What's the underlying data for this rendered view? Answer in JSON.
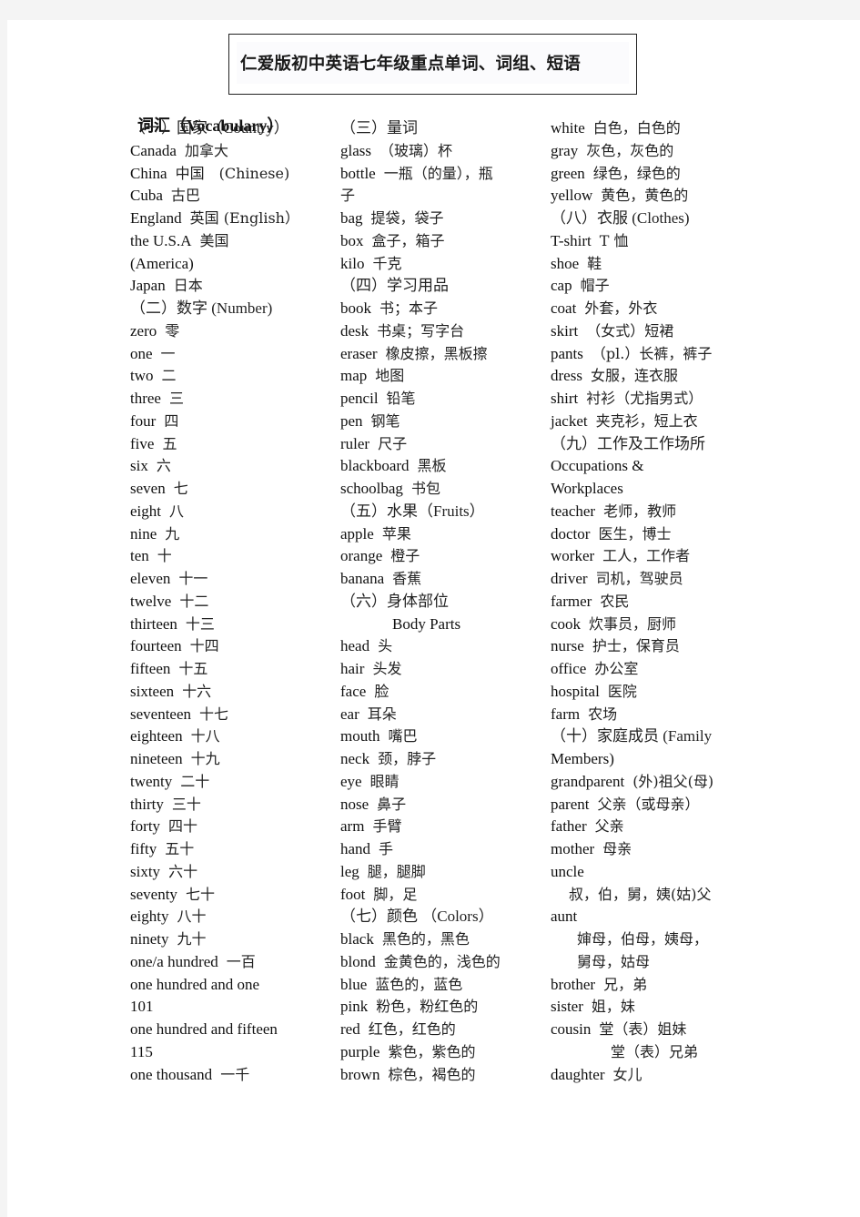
{
  "document": {
    "title": "仁爱版初中英语七年级重点单词、词组、短语",
    "vocab_heading": "词汇（Vocabulary）"
  },
  "columns": [
    {
      "lines": [
        {
          "type": "section",
          "text": "（一）国家（Country）"
        },
        {
          "type": "entry",
          "en": "Canada",
          "zh": "加拿大"
        },
        {
          "type": "entry",
          "en": "China",
          "zh": "中国　(Chinese)"
        },
        {
          "type": "entry",
          "en": "Cuba",
          "zh": "古巴"
        },
        {
          "type": "entry",
          "en": "England",
          "zh": "英国 (English）"
        },
        {
          "type": "entry",
          "en": "the U.S.A",
          "zh": "美国"
        },
        {
          "type": "text",
          "text": "(America)"
        },
        {
          "type": "entry",
          "en": "Japan",
          "zh": "日本"
        },
        {
          "type": "section",
          "text": "（二）数字 (Number)"
        },
        {
          "type": "entry",
          "en": "zero",
          "zh": "零"
        },
        {
          "type": "entry",
          "en": "one",
          "zh": "一"
        },
        {
          "type": "entry",
          "en": "two",
          "zh": "二"
        },
        {
          "type": "entry",
          "en": "three",
          "zh": "三"
        },
        {
          "type": "entry",
          "en": "four",
          "zh": "四"
        },
        {
          "type": "entry",
          "en": "five",
          "zh": "五"
        },
        {
          "type": "entry",
          "en": "six",
          "zh": "六"
        },
        {
          "type": "entry",
          "en": "seven",
          "zh": "七"
        },
        {
          "type": "entry",
          "en": "eight",
          "zh": "八"
        },
        {
          "type": "entry",
          "en": "nine",
          "zh": "九"
        },
        {
          "type": "entry",
          "en": "ten",
          "zh": "十"
        },
        {
          "type": "entry",
          "en": "eleven",
          "zh": "十一"
        },
        {
          "type": "entry",
          "en": "twelve",
          "zh": "十二"
        },
        {
          "type": "entry",
          "en": "thirteen",
          "zh": "十三"
        },
        {
          "type": "entry",
          "en": "fourteen",
          "zh": "十四"
        },
        {
          "type": "entry",
          "en": "fifteen",
          "zh": "十五"
        },
        {
          "type": "entry",
          "en": "sixteen",
          "zh": "十六"
        },
        {
          "type": "entry",
          "en": "seventeen",
          "zh": "十七"
        },
        {
          "type": "entry",
          "en": "eighteen",
          "zh": "十八"
        },
        {
          "type": "entry",
          "en": "nineteen",
          "zh": "十九"
        },
        {
          "type": "entry",
          "en": "twenty",
          "zh": "二十"
        },
        {
          "type": "entry",
          "en": "thirty",
          "zh": "三十"
        },
        {
          "type": "entry",
          "en": "forty",
          "zh": "四十"
        },
        {
          "type": "entry",
          "en": "fifty",
          "zh": "五十"
        },
        {
          "type": "entry",
          "en": "sixty",
          "zh": "六十"
        },
        {
          "type": "entry",
          "en": "seventy",
          "zh": "七十"
        },
        {
          "type": "entry",
          "en": "eighty",
          "zh": "八十"
        },
        {
          "type": "entry",
          "en": "ninety",
          "zh": "九十"
        },
        {
          "type": "entry",
          "en": "one/a hundred",
          "zh": "一百"
        },
        {
          "type": "text",
          "text": "one hundred and one"
        },
        {
          "type": "text",
          "text": "101"
        },
        {
          "type": "text",
          "text": "one hundred and fifteen"
        },
        {
          "type": "text",
          "text": "115"
        },
        {
          "type": "entry",
          "en": "one thousand",
          "zh": "一千"
        }
      ]
    },
    {
      "lines": [
        {
          "type": "section",
          "text": "（三）量词"
        },
        {
          "type": "entry",
          "en": "glass",
          "zh": "（玻璃）杯"
        },
        {
          "type": "entry",
          "en": "bottle",
          "zh": "一瓶（的量），瓶"
        },
        {
          "type": "zh-only",
          "text": "子"
        },
        {
          "type": "entry",
          "en": "bag",
          "zh": "提袋，袋子"
        },
        {
          "type": "entry",
          "en": "box",
          "zh": "盒子，箱子"
        },
        {
          "type": "entry",
          "en": "kilo",
          "zh": "千克"
        },
        {
          "type": "section",
          "text": "（四）学习用品"
        },
        {
          "type": "entry",
          "en": "book",
          "zh": "书；本子"
        },
        {
          "type": "entry",
          "en": "desk",
          "zh": "书桌；写字台"
        },
        {
          "type": "entry",
          "en": "eraser",
          "zh": "橡皮擦，黑板擦"
        },
        {
          "type": "entry",
          "en": "map",
          "zh": "地图"
        },
        {
          "type": "entry",
          "en": "pencil",
          "zh": "铅笔"
        },
        {
          "type": "entry",
          "en": "pen",
          "zh": "钢笔"
        },
        {
          "type": "entry",
          "en": "ruler",
          "zh": "尺子"
        },
        {
          "type": "entry",
          "en": "blackboard",
          "zh": "黑板"
        },
        {
          "type": "entry",
          "en": "schoolbag",
          "zh": "书包"
        },
        {
          "type": "section",
          "text": "（五）水果（Fruits）"
        },
        {
          "type": "entry",
          "en": "apple",
          "zh": "苹果"
        },
        {
          "type": "entry",
          "en": "orange",
          "zh": "橙子"
        },
        {
          "type": "entry",
          "en": "banana",
          "zh": "香蕉"
        },
        {
          "type": "section",
          "text": "（六）身体部位"
        },
        {
          "type": "subsection",
          "text": "Body  Parts"
        },
        {
          "type": "entry",
          "en": "head",
          "zh": "头"
        },
        {
          "type": "entry",
          "en": "hair",
          "zh": "头发"
        },
        {
          "type": "entry",
          "en": "face",
          "zh": "脸"
        },
        {
          "type": "entry",
          "en": "ear",
          "zh": "耳朵"
        },
        {
          "type": "entry",
          "en": "mouth",
          "zh": "嘴巴"
        },
        {
          "type": "entry",
          "en": "neck",
          "zh": "颈，脖子"
        },
        {
          "type": "entry",
          "en": "eye",
          "zh": "眼睛"
        },
        {
          "type": "entry",
          "en": "nose",
          "zh": "鼻子"
        },
        {
          "type": "entry",
          "en": "arm",
          "zh": "手臂"
        },
        {
          "type": "entry",
          "en": "hand",
          "zh": "手"
        },
        {
          "type": "entry",
          "en": "leg",
          "zh": "腿，腿脚"
        },
        {
          "type": "entry",
          "en": "foot",
          "zh": "脚，足"
        },
        {
          "type": "section",
          "text": "（七）颜色 （Colors）"
        },
        {
          "type": "entry",
          "en": "black",
          "zh": "黑色的，黑色"
        },
        {
          "type": "entry",
          "en": "blond",
          "zh": "金黄色的，浅色的"
        },
        {
          "type": "entry",
          "en": "blue",
          "zh": "蓝色的，蓝色"
        },
        {
          "type": "entry",
          "en": "pink",
          "zh": "粉色，粉红色的"
        },
        {
          "type": "entry",
          "en": "red",
          "zh": "红色，红色的"
        },
        {
          "type": "entry",
          "en": "purple",
          "zh": "紫色，紫色的"
        },
        {
          "type": "entry",
          "en": "brown",
          "zh": "棕色，褐色的"
        }
      ]
    },
    {
      "lines": [
        {
          "type": "entry",
          "en": "white",
          "zh": "白色，白色的"
        },
        {
          "type": "entry",
          "en": "gray",
          "zh": "灰色，灰色的"
        },
        {
          "type": "entry",
          "en": "green",
          "zh": "绿色，绿色的"
        },
        {
          "type": "entry",
          "en": "yellow",
          "zh": "黄色，黄色的"
        },
        {
          "type": "section",
          "text": "（八）衣服 (Clothes)"
        },
        {
          "type": "entry",
          "en": "T-shirt",
          "zh": "T 恤"
        },
        {
          "type": "entry",
          "en": "shoe",
          "zh": "鞋"
        },
        {
          "type": "entry",
          "en": "cap",
          "zh": "帽子"
        },
        {
          "type": "entry",
          "en": "coat",
          "zh": "外套，外衣"
        },
        {
          "type": "entry",
          "en": "skirt",
          "zh": "（女式）短裙"
        },
        {
          "type": "entry",
          "en": "pants",
          "zh": "（pl.）长裤，裤子"
        },
        {
          "type": "entry",
          "en": "dress",
          "zh": "女服，连衣服"
        },
        {
          "type": "entry",
          "en": "shirt",
          "zh": "衬衫（尤指男式）"
        },
        {
          "type": "entry",
          "en": "jacket",
          "zh": "夹克衫，短上衣"
        },
        {
          "type": "section",
          "text": "（九）工作及工作场所"
        },
        {
          "type": "text",
          "text": "Occupations  &"
        },
        {
          "type": "text",
          "text": "Workplaces"
        },
        {
          "type": "entry",
          "en": "teacher",
          "zh": "老师，教师"
        },
        {
          "type": "entry",
          "en": "doctor",
          "zh": "医生，博士"
        },
        {
          "type": "entry",
          "en": "worker",
          "zh": "工人，工作者"
        },
        {
          "type": "entry",
          "en": "driver",
          "zh": "司机，驾驶员"
        },
        {
          "type": "entry",
          "en": "farmer",
          "zh": "农民"
        },
        {
          "type": "entry",
          "en": "cook",
          "zh": "炊事员，厨师"
        },
        {
          "type": "entry",
          "en": "nurse",
          "zh": "护士，保育员"
        },
        {
          "type": "entry",
          "en": "office",
          "zh": "办公室"
        },
        {
          "type": "entry",
          "en": "hospital",
          "zh": "医院"
        },
        {
          "type": "entry",
          "en": "farm",
          "zh": "农场"
        },
        {
          "type": "section",
          "text": "（十）家庭成员 (Family"
        },
        {
          "type": "text",
          "text": "Members)"
        },
        {
          "type": "entry",
          "en": "grandparent",
          "zh": "(外)祖父(母)"
        },
        {
          "type": "entry",
          "en": "parent",
          "zh": "父亲（或母亲）"
        },
        {
          "type": "entry",
          "en": "father",
          "zh": "父亲"
        },
        {
          "type": "entry",
          "en": "mother",
          "zh": "母亲"
        },
        {
          "type": "text",
          "text": "uncle"
        },
        {
          "type": "zh-indent-a",
          "text": "叔，伯，舅，姨(姑)父"
        },
        {
          "type": "text",
          "text": "aunt"
        },
        {
          "type": "zh-indent-b",
          "text": "婶母，伯母，姨母，"
        },
        {
          "type": "zh-indent-b",
          "text": "舅母，姑母"
        },
        {
          "type": "entry",
          "en": "brother",
          "zh": "兄，弟"
        },
        {
          "type": "entry",
          "en": "sister",
          "zh": "姐，妹"
        },
        {
          "type": "entry",
          "en": "cousin",
          "zh": "堂（表）姐妹"
        },
        {
          "type": "zh-indent-c",
          "text": "堂（表）兄弟"
        },
        {
          "type": "entry",
          "en": "daughter",
          "zh": "女儿"
        }
      ]
    }
  ]
}
